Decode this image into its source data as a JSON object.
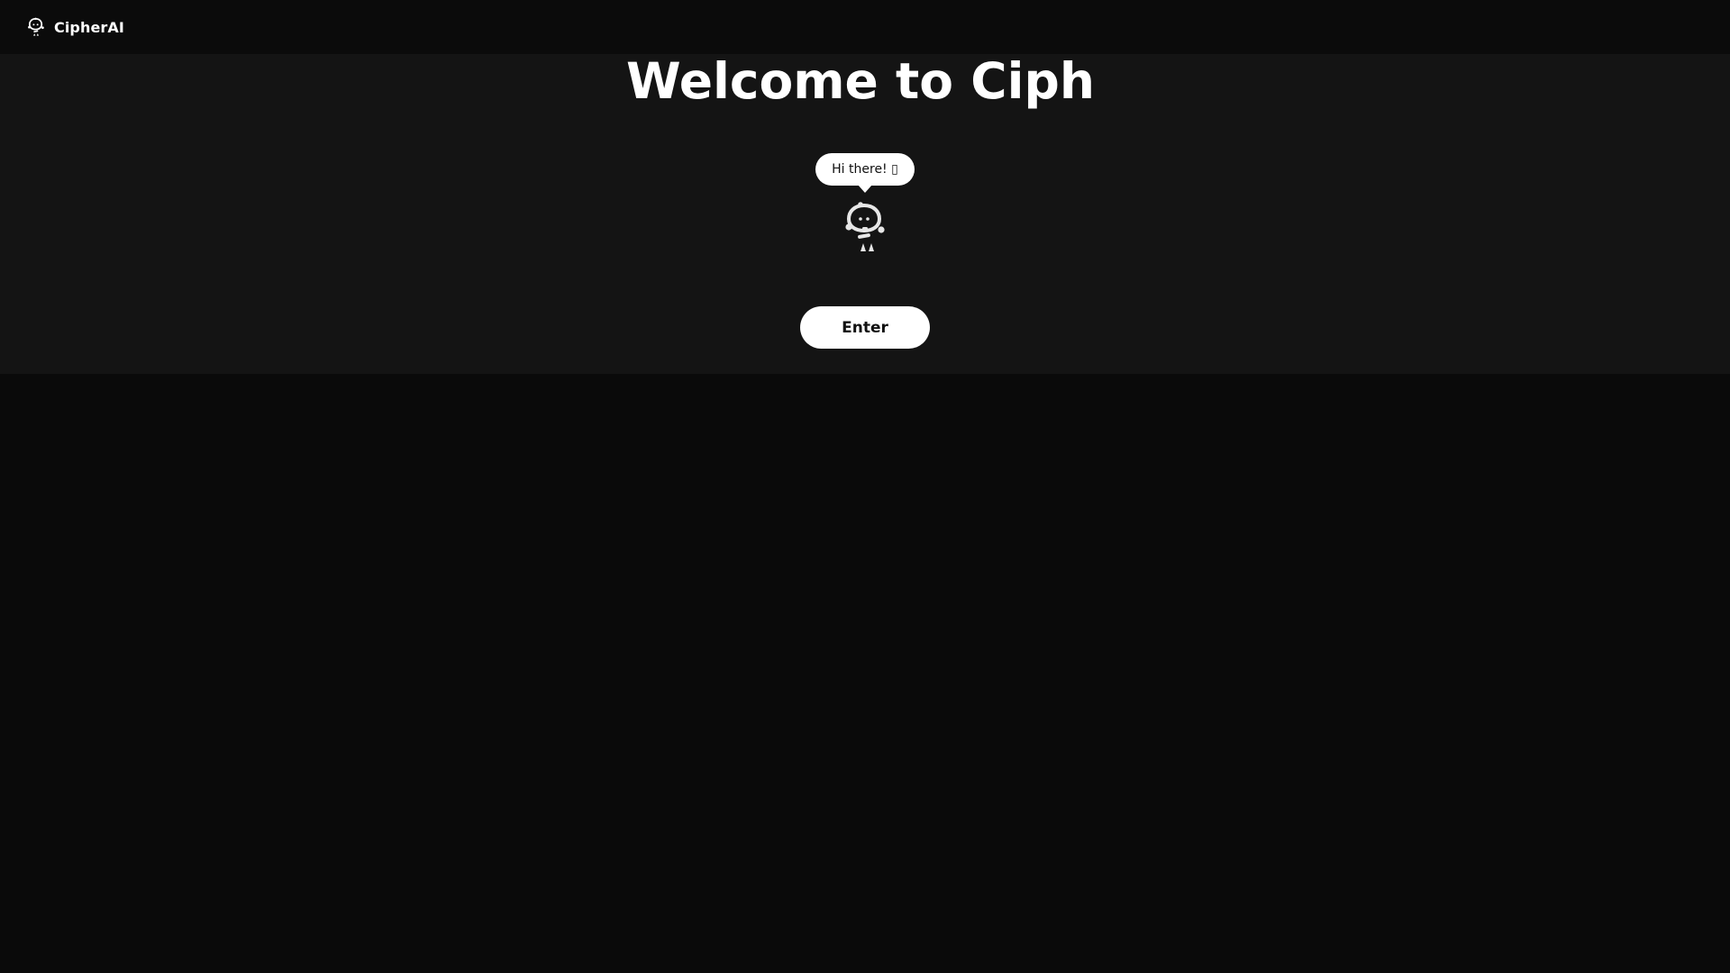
{
  "navbar": {
    "brand_name": "CipherAI",
    "brand_icon": "robot-mascot-icon"
  },
  "hero": {
    "title": "Welcome to Ciph",
    "greeting": "Hi there! ▯",
    "mascot_icon": "robot-mascot-icon",
    "enter_label": "Enter"
  },
  "colors": {
    "page_background": "#0a0a0a",
    "navbar_background": "#0b0b0b",
    "hero_background": "#141414",
    "text_primary": "#ffffff",
    "button_background": "#ffffff",
    "button_text": "#111111"
  }
}
